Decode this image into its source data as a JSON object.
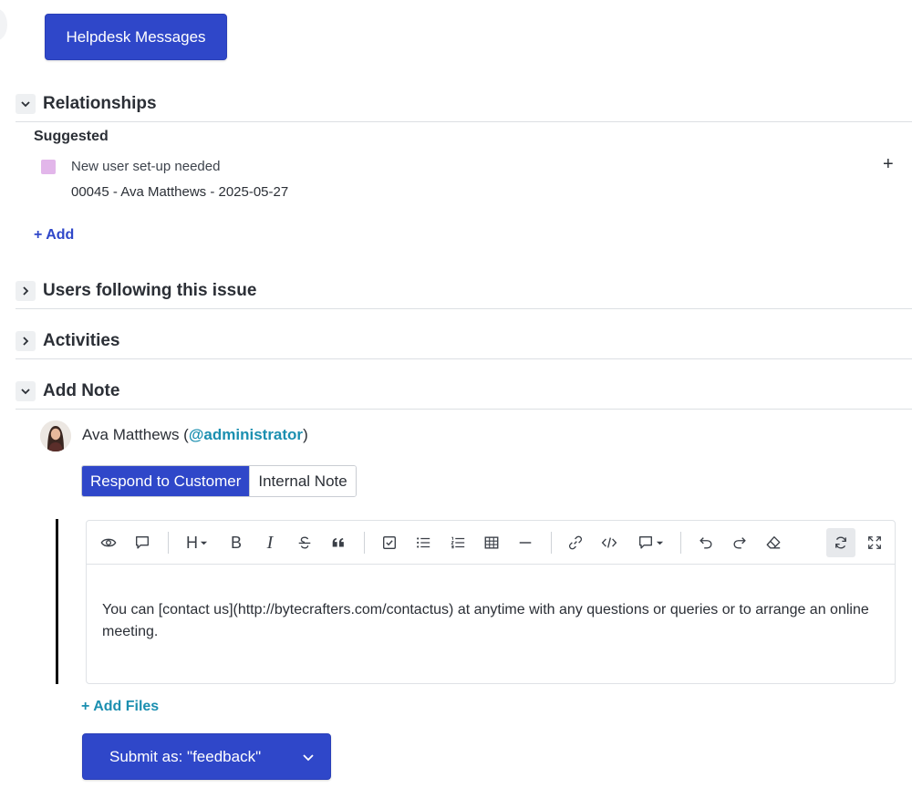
{
  "header": {
    "helpdesk_button": "Helpdesk Messages"
  },
  "relationships": {
    "title": "Relationships",
    "expanded": true,
    "suggested_label": "Suggested",
    "items": [
      {
        "title": "New user set-up needed",
        "meta": "00045 - Ava Matthews - 2025-05-27",
        "color": "#e2b6ea"
      }
    ],
    "add_label": "+ Add"
  },
  "users_following": {
    "title": "Users following this issue",
    "expanded": false
  },
  "activities": {
    "title": "Activities",
    "expanded": false
  },
  "add_note": {
    "title": "Add Note",
    "expanded": true,
    "author": {
      "name": "Ava Matthews (",
      "handle": "@administrator",
      "suffix": ")"
    },
    "tabs": [
      {
        "label": "Respond to Customer",
        "active": true
      },
      {
        "label": "Internal Note",
        "active": false
      }
    ],
    "editor": {
      "toolbar": [
        "eye-icon",
        "comment-icon",
        "heading-icon",
        "bold-icon",
        "italic-icon",
        "strikethrough-icon",
        "quote-icon",
        "checklist-icon",
        "bullet-list-icon",
        "numbered-list-icon",
        "table-icon",
        "horizontal-rule-icon",
        "link-icon",
        "code-icon",
        "comment-dropdown-icon",
        "undo-icon",
        "redo-icon",
        "eraser-icon",
        "sync-icon",
        "fullscreen-icon"
      ],
      "heading_glyph": "H",
      "bold_glyph": "B",
      "italic_glyph": "I",
      "content": "You can [contact us](http://bytecrafters.com/contactus) at anytime with any questions or queries or to arrange an online meeting."
    },
    "add_files_label": "+ Add Files",
    "submit_label": "Submit as: \"feedback\""
  },
  "colors": {
    "primary": "#2f47c9",
    "link": "#1b8fb0",
    "swatch": "#e2b6ea"
  }
}
